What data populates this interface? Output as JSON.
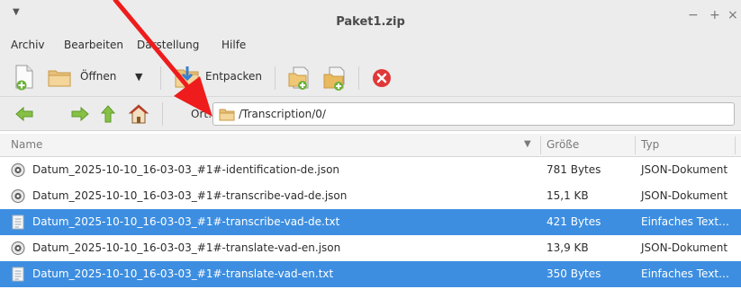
{
  "window": {
    "title": "Paket1.zip",
    "controls": {
      "minimize": "−",
      "maximize": "+",
      "close": "×"
    }
  },
  "menubar": {
    "items": [
      "Archiv",
      "Bearbeiten",
      "Darstellung",
      "Hilfe"
    ]
  },
  "toolbar": {
    "open_label": "Öffnen",
    "extract_label": "Entpacken"
  },
  "location": {
    "label": "Ort:",
    "path": "/Transcription/0/"
  },
  "columns": {
    "name": "Name",
    "size": "Größe",
    "type": "Typ"
  },
  "files": [
    {
      "name": "Datum_2025-10-10_16-03-03_#1#-identification-de.json",
      "size": "781 Bytes",
      "type": "JSON-Dokument",
      "selected": false,
      "icon": "json-file-icon"
    },
    {
      "name": "Datum_2025-10-10_16-03-03_#1#-transcribe-vad-de.json",
      "size": "15,1 KB",
      "type": "JSON-Dokument",
      "selected": false,
      "icon": "json-file-icon"
    },
    {
      "name": "Datum_2025-10-10_16-03-03_#1#-transcribe-vad-de.txt",
      "size": "421 Bytes",
      "type": "Einfaches Text…",
      "selected": true,
      "icon": "text-file-icon"
    },
    {
      "name": "Datum_2025-10-10_16-03-03_#1#-translate-vad-en.json",
      "size": "13,9 KB",
      "type": "JSON-Dokument",
      "selected": false,
      "icon": "json-file-icon"
    },
    {
      "name": "Datum_2025-10-10_16-03-03_#1#-translate-vad-en.txt",
      "size": "350 Bytes",
      "type": "Einfaches Text…",
      "selected": true,
      "icon": "text-file-icon"
    }
  ],
  "colors": {
    "selection": "#3d8ee0",
    "annotation_arrow": "#ee1c1c",
    "chrome": "#ececec"
  }
}
